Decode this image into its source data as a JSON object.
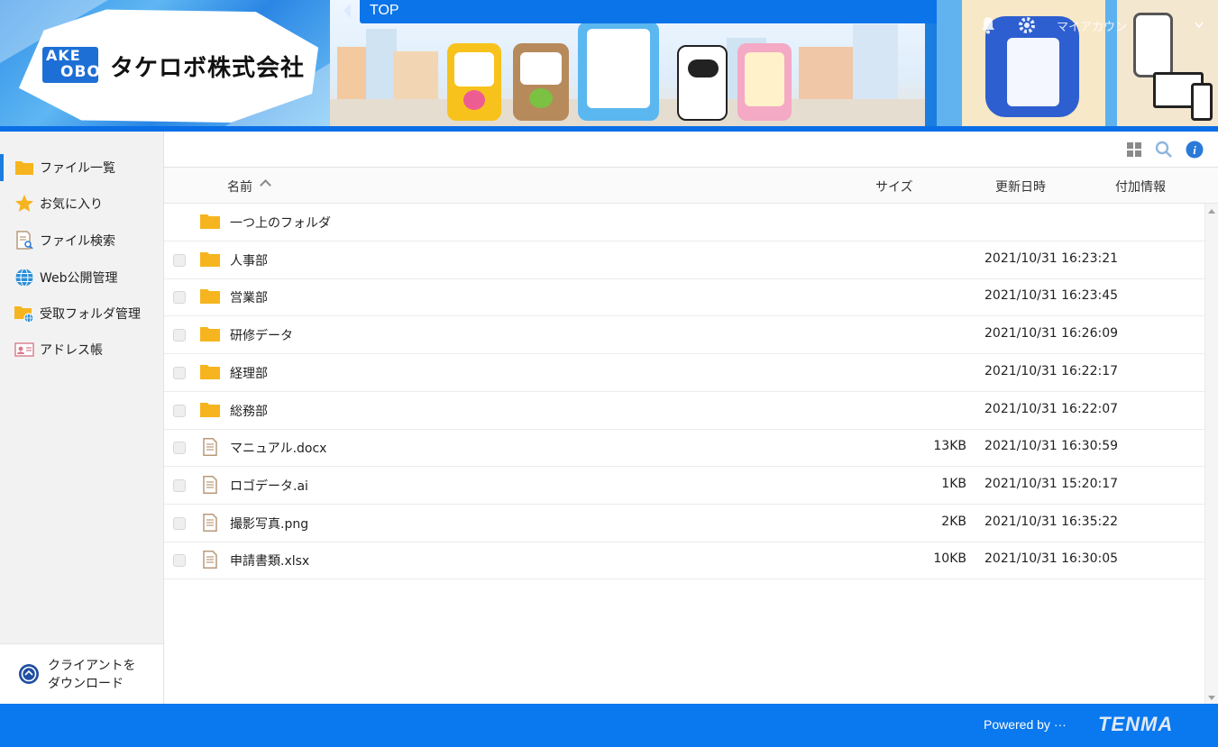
{
  "header": {
    "logo_line1": "AKE",
    "logo_line2": "OBO",
    "company_name": "タケロボ株式会社",
    "nav_label": "TOP",
    "account_label": "マイアカウン"
  },
  "sidebar": {
    "items": [
      {
        "label": "ファイル一覧",
        "icon": "folder-icon",
        "active": true
      },
      {
        "label": "お気に入り",
        "icon": "star-icon"
      },
      {
        "label": "ファイル検索",
        "icon": "file-search-icon"
      },
      {
        "label": "Web公開管理",
        "icon": "globe-icon"
      },
      {
        "label": "受取フォルダ管理",
        "icon": "folder-globe-icon"
      },
      {
        "label": "アドレス帳",
        "icon": "address-card-icon"
      }
    ],
    "client_download_line1": "クライアントを",
    "client_download_line2": "ダウンロード"
  },
  "toolbar": {
    "icons": [
      "grid-view-icon",
      "search-icon",
      "info-icon"
    ]
  },
  "table": {
    "columns": {
      "name": "名前",
      "size": "サイズ",
      "modified": "更新日時",
      "extra": "付加情報"
    },
    "parent_folder": "一つ上のフォルダ",
    "rows": [
      {
        "name": "人事部",
        "type": "folder",
        "size": "",
        "modified": "2021/10/31 16:23:21"
      },
      {
        "name": "営業部",
        "type": "folder",
        "size": "",
        "modified": "2021/10/31 16:23:45"
      },
      {
        "name": "研修データ",
        "type": "folder",
        "size": "",
        "modified": "2021/10/31 16:26:09"
      },
      {
        "name": "経理部",
        "type": "folder",
        "size": "",
        "modified": "2021/10/31 16:22:17"
      },
      {
        "name": "総務部",
        "type": "folder",
        "size": "",
        "modified": "2021/10/31 16:22:07"
      },
      {
        "name": "マニュアル.docx",
        "type": "file",
        "size": "13KB",
        "modified": "2021/10/31 16:30:59"
      },
      {
        "name": "ロゴデータ.ai",
        "type": "file",
        "size": "1KB",
        "modified": "2021/10/31 15:20:17"
      },
      {
        "name": "撮影写真.png",
        "type": "file",
        "size": "2KB",
        "modified": "2021/10/31 16:35:22"
      },
      {
        "name": "申請書類.xlsx",
        "type": "file",
        "size": "10KB",
        "modified": "2021/10/31 16:30:05"
      }
    ]
  },
  "footer": {
    "powered_by": "Powered by ···",
    "brand": "TENMA"
  },
  "colors": {
    "accent": "#0a78ee",
    "folder": "#f6b51e",
    "file_icon": "#b89a7a"
  }
}
